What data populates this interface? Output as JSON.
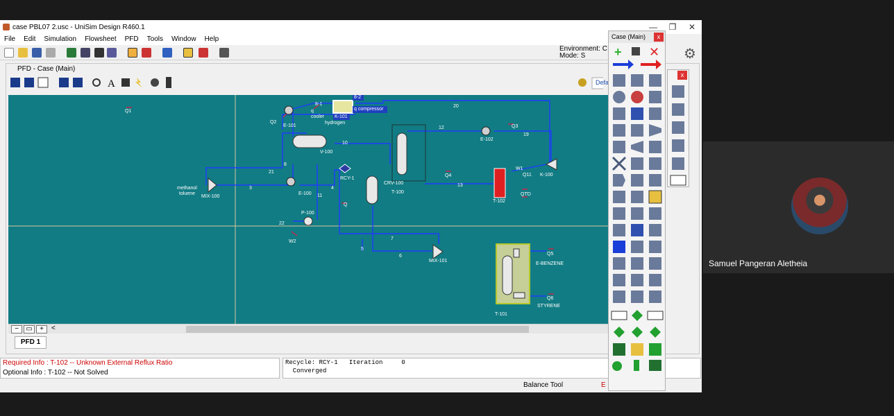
{
  "window": {
    "title": "case PBL07 2.usc - UniSim Design R460.1",
    "minimize": "—",
    "maximize": "❐",
    "close": "✕"
  },
  "menu": [
    "File",
    "Edit",
    "Simulation",
    "Flowsheet",
    "PFD",
    "Tools",
    "Window",
    "Help"
  ],
  "environment": {
    "line1": "Environment: C",
    "line2": "Mode: S"
  },
  "pfd": {
    "title": "PFD - Case (Main)",
    "tab": "PFD 1",
    "default_btn": "Defa",
    "zoom_minus": "−",
    "zoom_fit": "▭",
    "zoom_plus": "+",
    "scroll_left": "<"
  },
  "streams": {
    "q1": "Q1",
    "q2": "Q2",
    "e101": "E-101",
    "s81": "8-1",
    "qcooler": "q\ncooler",
    "k101": "K-101",
    "s82": "8-2",
    "qcompressor": "q compressor",
    "hydrogen": "hydrogen",
    "s20": "20",
    "s12": "12",
    "e102": "E-102",
    "q3": "Q3",
    "s19": "19",
    "v100": "V-100",
    "s10": "10",
    "s8": "8",
    "s21": "21",
    "rcy1": "RCY-1",
    "crv100": "CRV-100",
    "t100": "T-100",
    "q4": "Q4",
    "s13": "13",
    "t102": "T-102",
    "w1": "W1",
    "q11": "Q11",
    "qtd": "QTD",
    "k100": "K-100",
    "mix100": "MIX-100",
    "methanol": "methanol",
    "toluene": "toluene",
    "s3": "3",
    "e100": "E-100",
    "s4": "4",
    "s11": "11",
    "q": "Q",
    "p100": "P-100",
    "s22": "22",
    "w2": "W2",
    "s7": "7",
    "s5": "5",
    "s6": "6",
    "mix101": "MIX-101",
    "q5": "Q5",
    "ebenzene": "E-BENZENE",
    "q6": "Q6",
    "styrene": "STYRENE",
    "t101": "T-101"
  },
  "status": {
    "required": "Required Info : T-102 -- Unknown External Reflux Ratio",
    "optional": "Optional Info : T-102 -- Not Solved",
    "recycle_line": "Recycle: RCY-1   Iteration     0",
    "converged": "  Converged",
    "balance_tool": "Balance Tool",
    "red_e": "E"
  },
  "palette": {
    "title": "Case (Main)",
    "close": "x",
    "sub_close": "x"
  },
  "participant": {
    "name": "Samuel Pangeran Aletheia"
  },
  "colors": {
    "canvas": "#117c84",
    "stream": "#1f3cff",
    "energy": "#d0204a"
  }
}
